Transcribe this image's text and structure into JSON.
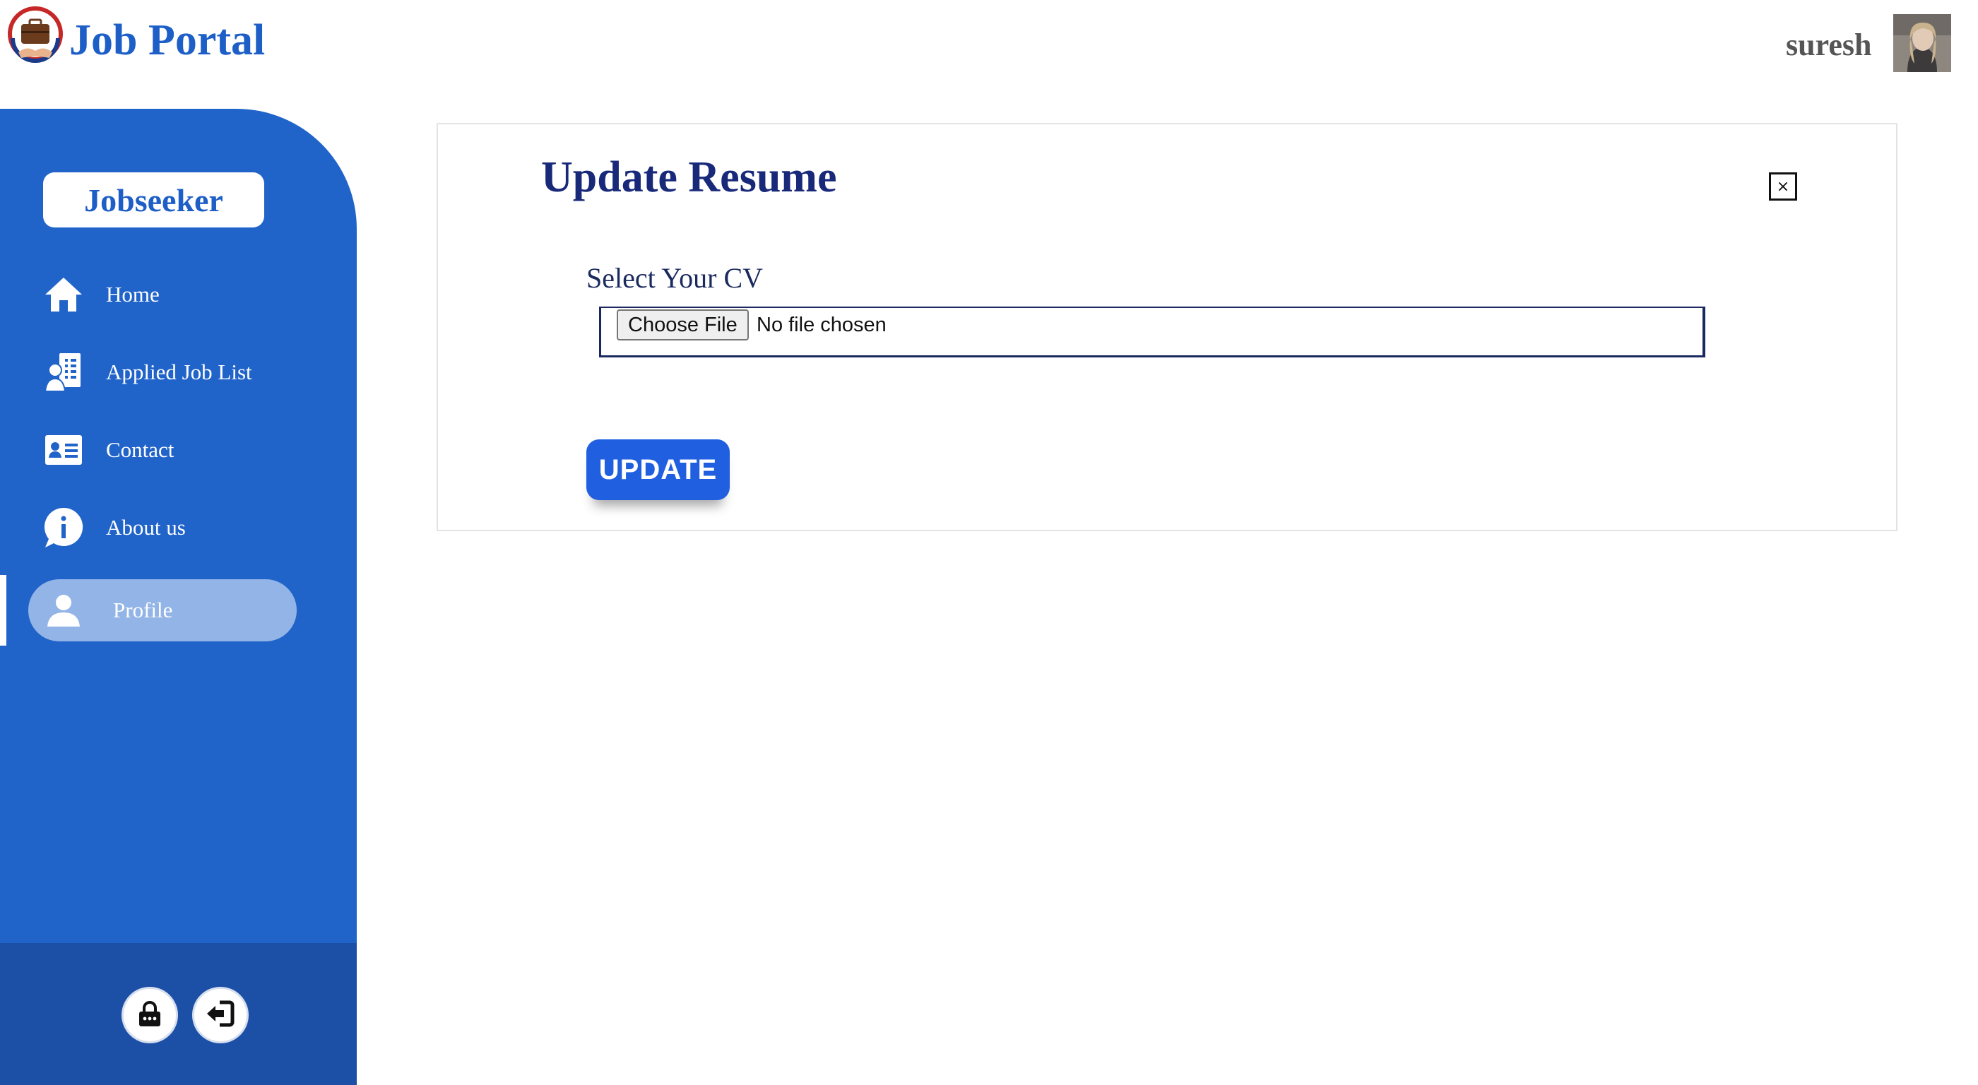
{
  "header": {
    "brand": "Job Portal",
    "username": "suresh",
    "logo_icon": "briefcase-icon",
    "avatar_icon": "user-avatar"
  },
  "sidebar": {
    "role_label": "Jobseeker",
    "items": [
      {
        "label": "Home",
        "icon": "home-icon"
      },
      {
        "label": "Applied Job List",
        "icon": "job-list-icon"
      },
      {
        "label": "Contact",
        "icon": "contact-card-icon"
      },
      {
        "label": "About us",
        "icon": "info-icon"
      },
      {
        "label": "Profile",
        "icon": "user-icon",
        "active": true
      }
    ],
    "footer_buttons": [
      {
        "icon": "lock-icon"
      },
      {
        "icon": "logout-icon"
      }
    ]
  },
  "main": {
    "title": "Update Resume",
    "close_label": "×",
    "field_label": "Select Your CV",
    "file_input": {
      "button_label": "Choose File",
      "status": "No file chosen"
    },
    "submit_label": "UPDATE"
  },
  "colors": {
    "sidebar": "#2164c9",
    "sidebar_footer": "#1c4fa6",
    "active_item": "#93b4e6",
    "brand": "#1d5fc7",
    "title": "#19297a",
    "button": "#1f5fe0"
  }
}
